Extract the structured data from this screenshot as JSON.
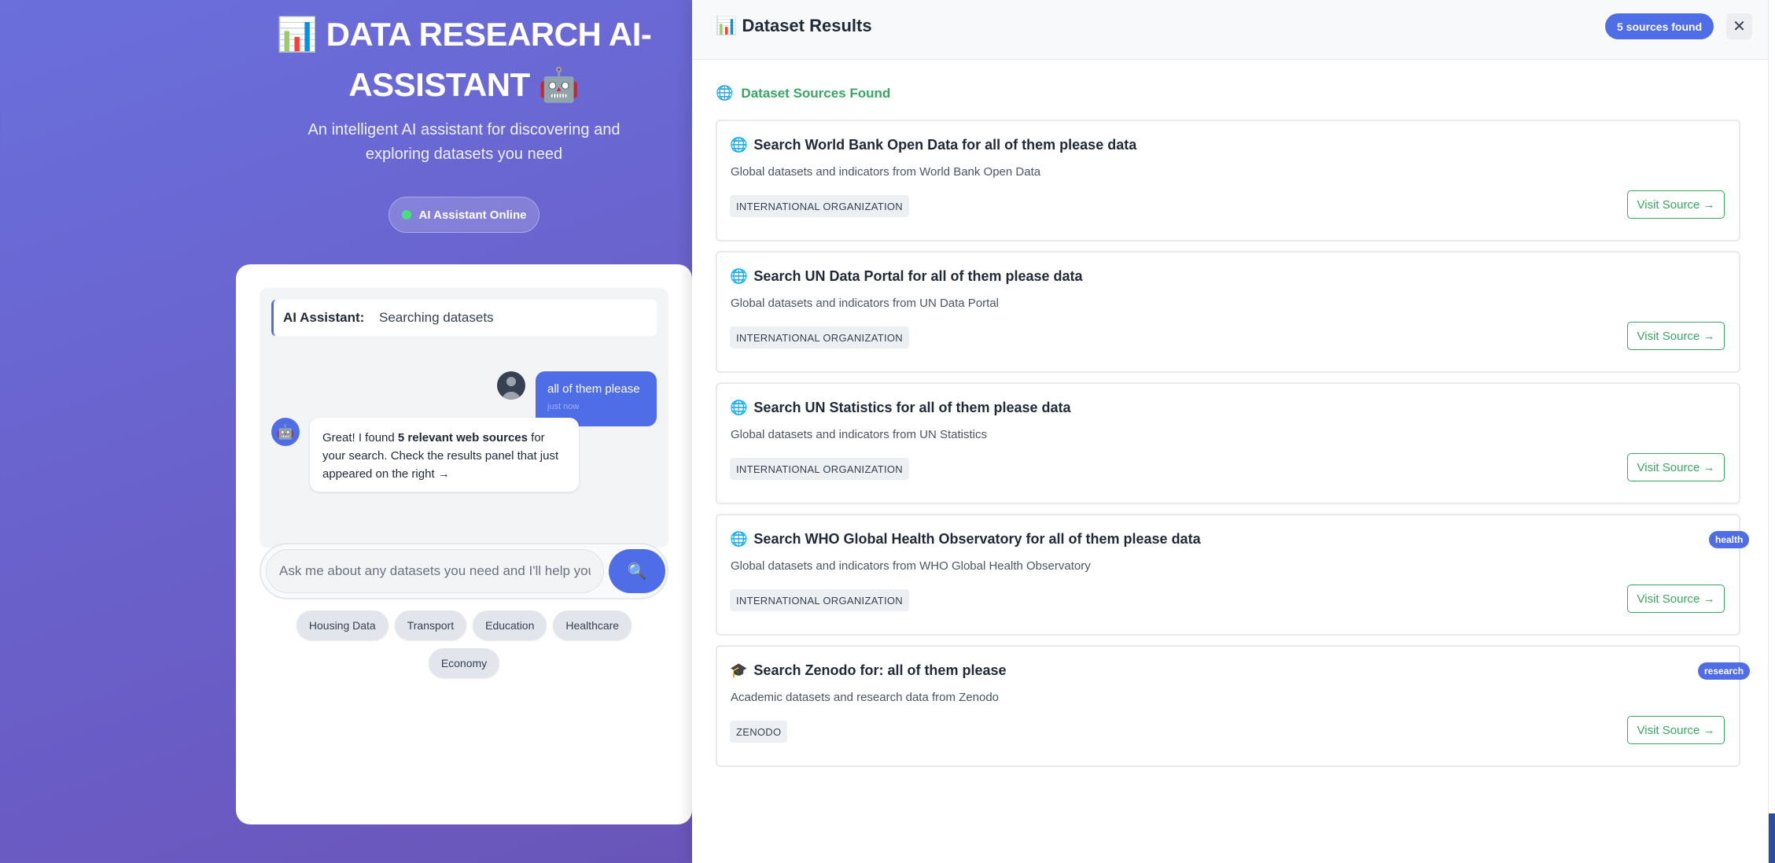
{
  "hero": {
    "title": "📊 DATA RESEARCH AI-ASSISTANT 🤖",
    "subtitle": "An intelligent AI assistant for discovering and exploring datasets you need",
    "status": "AI Assistant Online"
  },
  "chat": {
    "assistant_label": "AI Assistant:",
    "assistant_status": "Searching datasets",
    "user_message": "all of them please",
    "user_time": "just now",
    "bot_message_parts": [
      "Great! I found ",
      "5 relevant web sources",
      " for your search. Check the results panel that just appeared on the right →"
    ],
    "input_placeholder": "Ask me about any datasets you need and I'll help you find them",
    "search_icon": "🔍",
    "bot_icon": "🤖",
    "quick_tags": [
      "Housing Data",
      "Transport",
      "Education",
      "Healthcare",
      "Economy"
    ]
  },
  "panel": {
    "title": "📊 Dataset Results",
    "count_badge": "5 sources found",
    "close_icon": "✕",
    "section_title": "Dataset Sources Found",
    "results": [
      {
        "icon": "🌐",
        "title": "Search World Bank Open Data for all of them please data",
        "description": "Global datasets and indicators from World Bank Open Data",
        "tag": "INTERNATIONAL ORGANIZATION",
        "badge": "",
        "button": "Visit Source →"
      },
      {
        "icon": "🌐",
        "title": "Search UN Data Portal for all of them please data",
        "description": "Global datasets and indicators from UN Data Portal",
        "tag": "INTERNATIONAL ORGANIZATION",
        "badge": "",
        "button": "Visit Source →"
      },
      {
        "icon": "🌐",
        "title": "Search UN Statistics for all of them please data",
        "description": "Global datasets and indicators from UN Statistics",
        "tag": "INTERNATIONAL ORGANIZATION",
        "badge": "",
        "button": "Visit Source →"
      },
      {
        "icon": "🌐",
        "title": "Search WHO Global Health Observatory for all of them please data",
        "description": "Global datasets and indicators from WHO Global Health Observatory",
        "tag": "INTERNATIONAL ORGANIZATION",
        "badge": "health",
        "button": "Visit Source →"
      },
      {
        "icon": "🎓",
        "title": "Search Zenodo for: all of them please",
        "description": "Academic datasets and research data from Zenodo",
        "tag": "ZENODO",
        "badge": "research",
        "button": "Visit Source →"
      }
    ]
  },
  "colors": {
    "accent": "#4f6de6",
    "success": "#3aa664",
    "online": "#4ade80"
  }
}
